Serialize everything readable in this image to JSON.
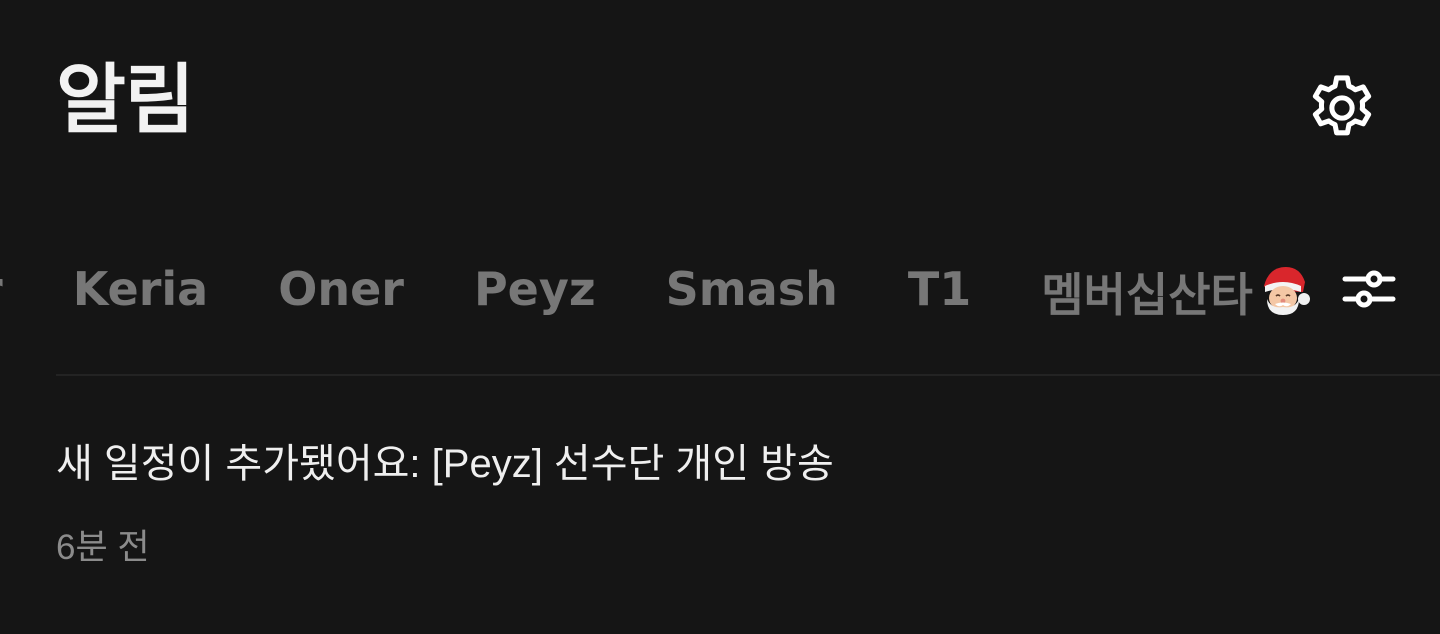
{
  "header": {
    "title": "알림",
    "settings_icon": "gear-icon"
  },
  "tabs": {
    "items": [
      {
        "label": "r"
      },
      {
        "label": "Keria"
      },
      {
        "label": "Oner"
      },
      {
        "label": "Peyz"
      },
      {
        "label": "Smash"
      },
      {
        "label": "T1"
      },
      {
        "label": "멤버십산타",
        "emoji": "santa-emoji"
      }
    ],
    "filter_icon": "filter-sliders-icon"
  },
  "notifications": [
    {
      "message": "새 일정이 추가됐어요: [Peyz] 선수단 개인 방송",
      "time": "6분 전"
    }
  ],
  "colors": {
    "background": "#151515",
    "title": "#f2f2f2",
    "tab_inactive": "#777777",
    "message": "#efefef",
    "time": "#8b8b8b",
    "divider": "#232323"
  }
}
